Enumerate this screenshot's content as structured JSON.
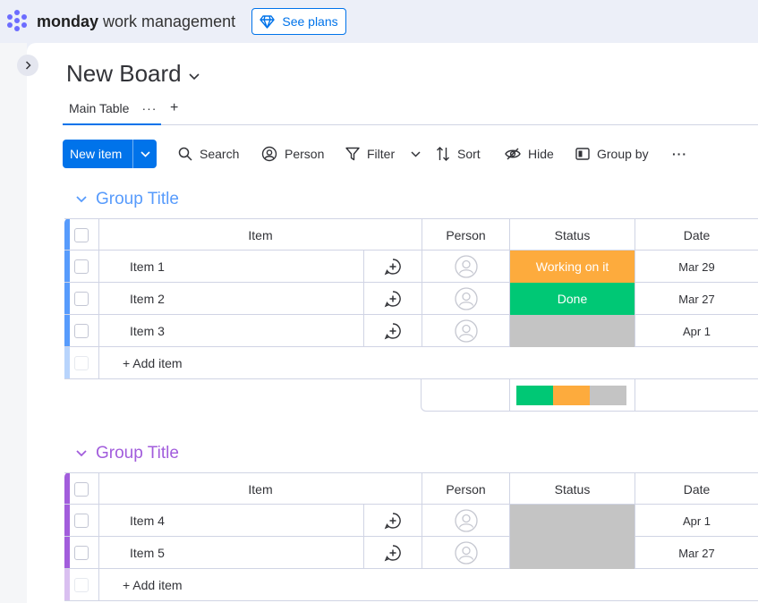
{
  "brand": {
    "name_bold": "monday",
    "name_light": " work management"
  },
  "topbar": {
    "see_plans_label": "See plans"
  },
  "board": {
    "title": "New Board"
  },
  "tabs": {
    "main_table_label": "Main Table",
    "more_label": "···",
    "add_label": "+"
  },
  "toolbar": {
    "new_item_label": "New item",
    "search_label": "Search",
    "person_label": "Person",
    "filter_label": "Filter",
    "sort_label": "Sort",
    "hide_label": "Hide",
    "group_by_label": "Group by",
    "more_label": "···"
  },
  "columns": {
    "item": "Item",
    "person": "Person",
    "status": "Status",
    "date": "Date"
  },
  "colors": {
    "accent": "#0073ea",
    "group1": "#579bfc",
    "group2": "#a25ddc",
    "working": "#fdab3d",
    "done": "#00c875",
    "empty": "#c4c4c4"
  },
  "groups": [
    {
      "title": "Group Title",
      "add_item_label": "+ Add item",
      "items": [
        {
          "name": "Item 1",
          "status": "Working on it",
          "date": "Mar 29"
        },
        {
          "name": "Item 2",
          "status": "Done",
          "date": "Mar 27"
        },
        {
          "name": "Item 3",
          "status": "",
          "date": "Apr 1"
        }
      ],
      "status_summary": {
        "done": 1,
        "working": 1,
        "empty": 1
      }
    },
    {
      "title": "Group Title",
      "add_item_label": "+ Add item",
      "items": [
        {
          "name": "Item 4",
          "status": "",
          "date": "Apr 1"
        },
        {
          "name": "Item 5",
          "status": "",
          "date": "Mar 27"
        }
      ]
    }
  ]
}
